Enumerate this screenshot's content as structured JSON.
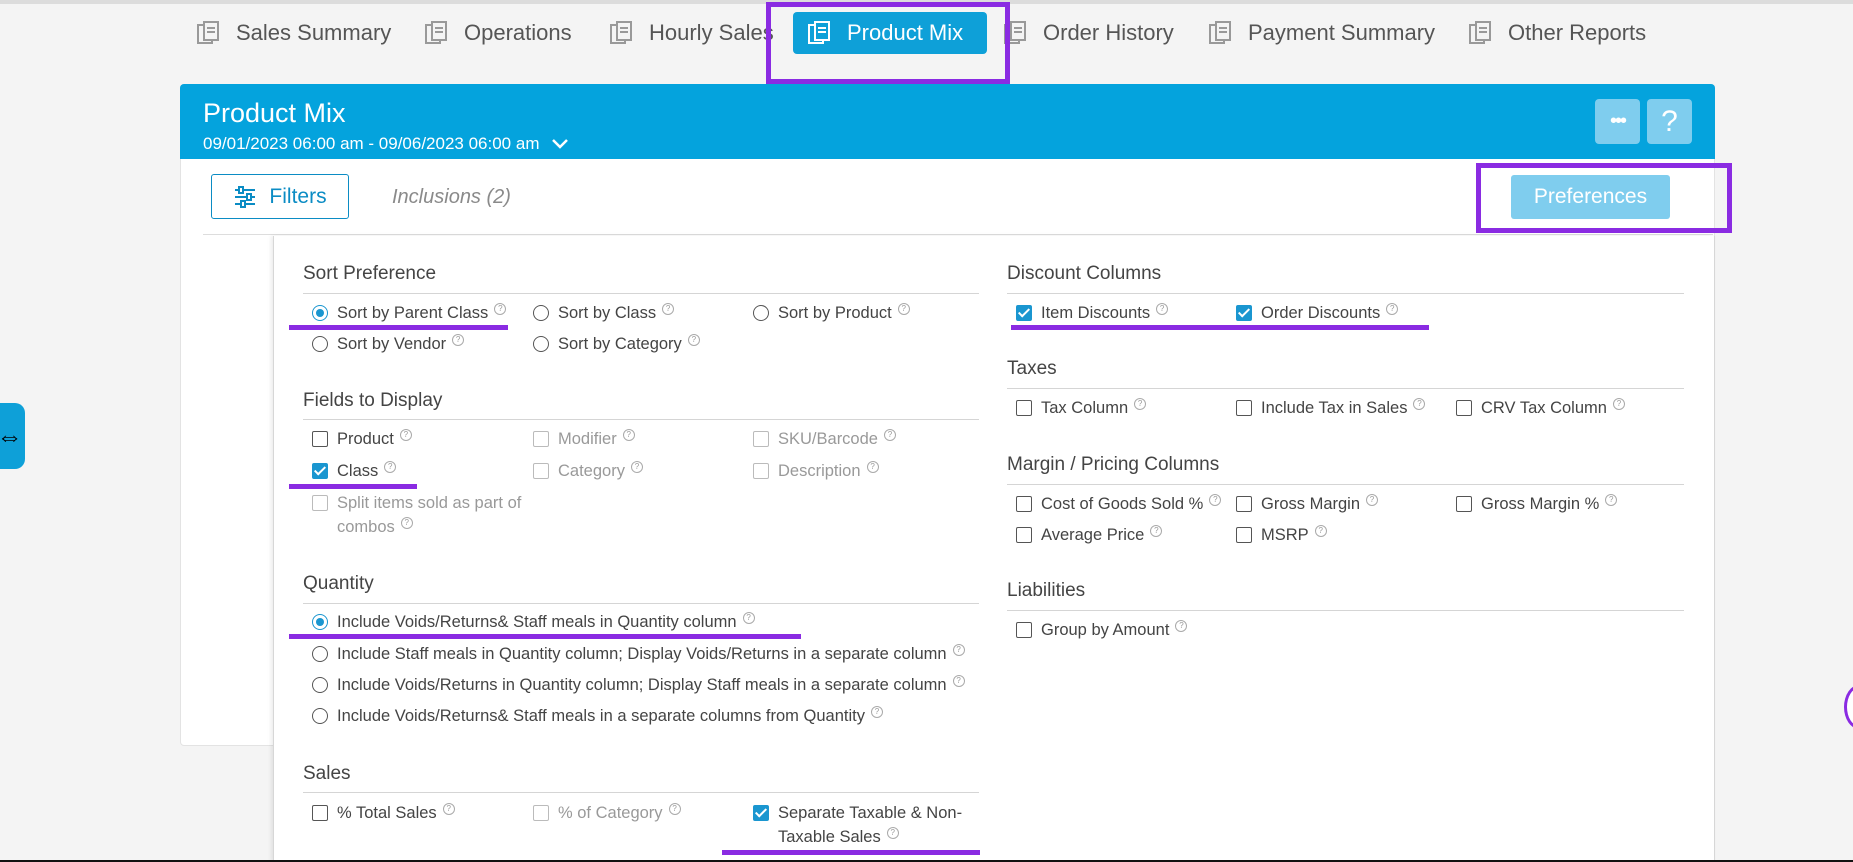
{
  "tabs": [
    {
      "label": "Sales Summary",
      "active": false
    },
    {
      "label": "Operations",
      "active": false
    },
    {
      "label": "Hourly Sales",
      "active": false
    },
    {
      "label": "Product Mix",
      "active": true
    },
    {
      "label": "Order History",
      "active": false
    },
    {
      "label": "Payment Summary",
      "active": false
    },
    {
      "label": "Other Reports",
      "active": false
    }
  ],
  "header": {
    "title": "Product Mix",
    "date_range": "09/01/2023 06:00 am - 09/06/2023 06:00 am",
    "more_label": "•••",
    "help_label": "?"
  },
  "toolbar": {
    "filters_label": "Filters",
    "inclusions_label": "Inclusions (2)",
    "preferences_label": "Preferences"
  },
  "help_glyph": "?",
  "sort_preference": {
    "title": "Sort Preference",
    "options": [
      {
        "label": "Sort by Parent Class",
        "selected": true
      },
      {
        "label": "Sort by Class",
        "selected": false
      },
      {
        "label": "Sort by Product",
        "selected": false
      },
      {
        "label": "Sort by Vendor",
        "selected": false
      },
      {
        "label": "Sort by Category",
        "selected": false
      }
    ]
  },
  "fields_to_display": {
    "title": "Fields to Display",
    "options": [
      {
        "label": "Product",
        "checked": false,
        "enabled": true
      },
      {
        "label": "Modifier",
        "checked": false,
        "enabled": false
      },
      {
        "label": "SKU/Barcode",
        "checked": false,
        "enabled": false
      },
      {
        "label": "Class",
        "checked": true,
        "enabled": true
      },
      {
        "label": "Category",
        "checked": false,
        "enabled": false
      },
      {
        "label": "Description",
        "checked": false,
        "enabled": false
      },
      {
        "label": "Split items sold as part of",
        "label_line2": "combos",
        "checked": false,
        "enabled": false
      }
    ]
  },
  "quantity": {
    "title": "Quantity",
    "options": [
      {
        "label": "Include Voids/Returns& Staff meals in Quantity column",
        "selected": true
      },
      {
        "label": "Include Staff meals in Quantity column; Display Voids/Returns in a separate column",
        "selected": false
      },
      {
        "label": "Include Voids/Returns in Quantity column; Display Staff meals in a separate column",
        "selected": false
      },
      {
        "label": "Include Voids/Returns& Staff meals in a separate columns from Quantity",
        "selected": false
      }
    ]
  },
  "sales": {
    "title": "Sales",
    "options": [
      {
        "label": "% Total Sales",
        "checked": false,
        "enabled": true
      },
      {
        "label": "% of Category",
        "checked": false,
        "enabled": false
      },
      {
        "label": "Separate Taxable & Non-",
        "label_line2": "Taxable Sales",
        "checked": true,
        "enabled": true
      }
    ]
  },
  "discount_columns": {
    "title": "Discount Columns",
    "options": [
      {
        "label": "Item Discounts",
        "checked": true
      },
      {
        "label": "Order Discounts",
        "checked": true
      }
    ]
  },
  "taxes": {
    "title": "Taxes",
    "options": [
      {
        "label": "Tax Column",
        "checked": false
      },
      {
        "label": "Include Tax in Sales",
        "checked": false
      },
      {
        "label": "CRV Tax Column",
        "checked": false
      }
    ]
  },
  "margin_pricing": {
    "title": "Margin / Pricing Columns",
    "options": [
      {
        "label": "Cost of Goods Sold %",
        "checked": false
      },
      {
        "label": "Gross Margin",
        "checked": false
      },
      {
        "label": "Gross Margin %",
        "checked": false
      },
      {
        "label": "Average Price",
        "checked": false
      },
      {
        "label": "MSRP",
        "checked": false
      }
    ]
  },
  "liabilities": {
    "title": "Liabilities",
    "options": [
      {
        "label": "Group by Amount",
        "checked": false
      }
    ]
  },
  "side_tab_glyph": "⇔",
  "colors": {
    "accent": "#04a3dd",
    "highlight": "#8a2be2",
    "button_light": "#7fcdee"
  }
}
